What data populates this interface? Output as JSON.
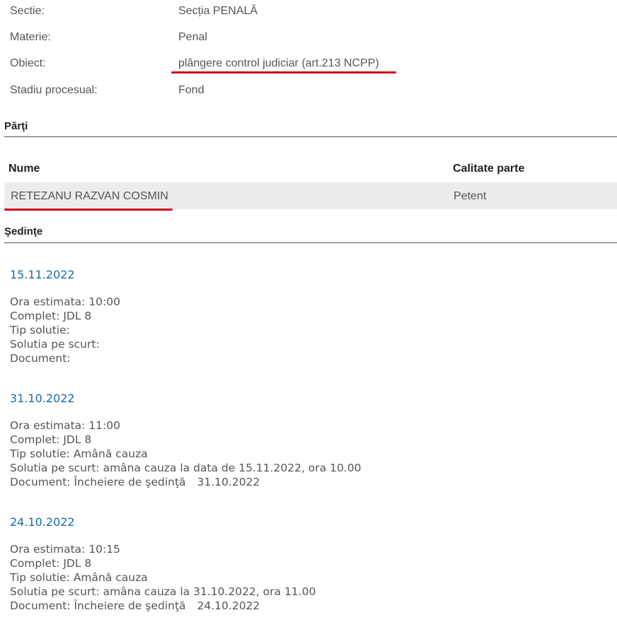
{
  "case_info": {
    "rows": [
      {
        "label": "Sectie:",
        "value": "Secția PENALĂ"
      },
      {
        "label": "Materie:",
        "value": "Penal"
      },
      {
        "label": "Obiect:",
        "value": "plângere control judiciar (art.213 NCPP)"
      },
      {
        "label": "Stadiu procesual:",
        "value": "Fond"
      }
    ]
  },
  "parties": {
    "title": "Părţi",
    "headers": {
      "name": "Nume",
      "role": "Calitate parte"
    },
    "rows": [
      {
        "name": "RETEZANU RAZVAN COSMIN",
        "role": "Petent"
      }
    ]
  },
  "sessions": {
    "title": "Şedinţe",
    "items": [
      {
        "date": "15.11.2022",
        "ora": "Ora estimata: 10:00",
        "complet": "Complet: JDL 8",
        "tip": "Tip solutie:",
        "solutia": "Solutia pe scurt:",
        "document": "Document:",
        "document_date": ""
      },
      {
        "date": "31.10.2022",
        "ora": "Ora estimata: 11:00",
        "complet": "Complet: JDL 8",
        "tip": "Tip solutie: Amână cauza",
        "solutia": "Solutia pe scurt: amâna cauza la data de 15.11.2022, ora 10.00",
        "document": "Document: Încheiere de şedinţă",
        "document_date": "31.10.2022"
      },
      {
        "date": "24.10.2022",
        "ora": "Ora estimata: 10:15",
        "complet": "Complet: JDL 8",
        "tip": "Tip solutie: Amână cauza",
        "solutia": "Solutia pe scurt: amâna cauza la 31.10.2022, ora 11.00",
        "document": "Document: Încheiere de şedinţă",
        "document_date": "24.10.2022"
      }
    ]
  },
  "colors": {
    "date_link": "#1a6aa8",
    "annotation_underline": "#d0021b",
    "row_highlight": "#ececec"
  }
}
